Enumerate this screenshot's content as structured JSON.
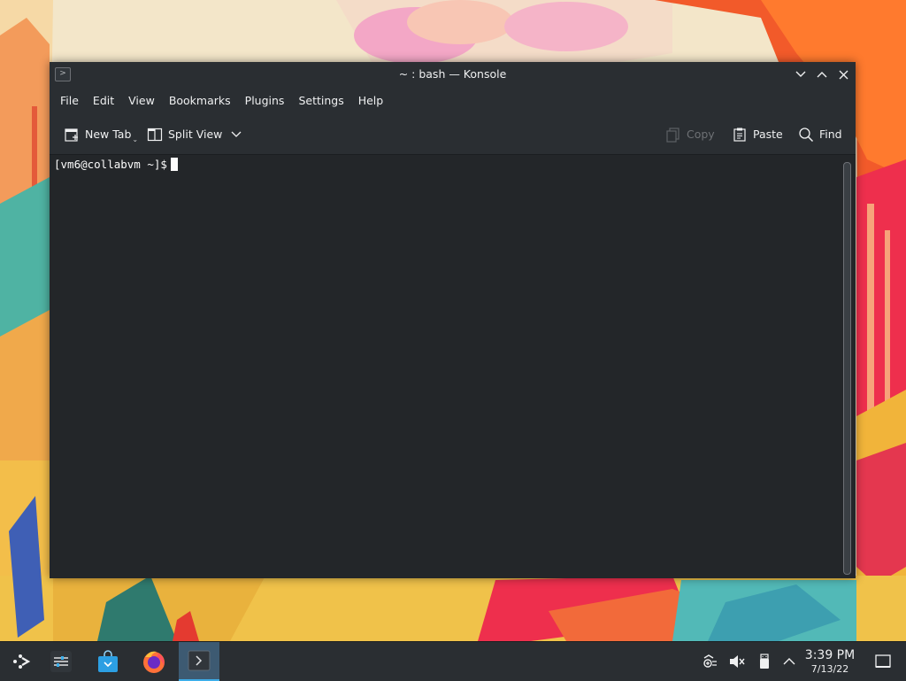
{
  "window": {
    "title": "~ : bash — Konsole"
  },
  "menubar": {
    "items": [
      "File",
      "Edit",
      "View",
      "Bookmarks",
      "Plugins",
      "Settings",
      "Help"
    ]
  },
  "toolbar": {
    "new_tab_label": "New Tab",
    "split_view_label": "Split View",
    "copy_label": "Copy",
    "paste_label": "Paste",
    "find_label": "Find"
  },
  "terminal": {
    "prompt": "[vm6@collabvm ~]$"
  },
  "taskbar": {
    "apps": [
      "application-launcher-icon",
      "system-settings-icon",
      "discover-store-icon",
      "firefox-icon",
      "konsole-icon"
    ],
    "active_app": "konsole-icon",
    "clock": {
      "time": "3:39 PM",
      "date": "7/13/22"
    }
  },
  "colors": {
    "titlebar": "#2a2e32",
    "terminal_bg": "#232629",
    "accent": "#3daee9",
    "text": "#eff0f1"
  }
}
